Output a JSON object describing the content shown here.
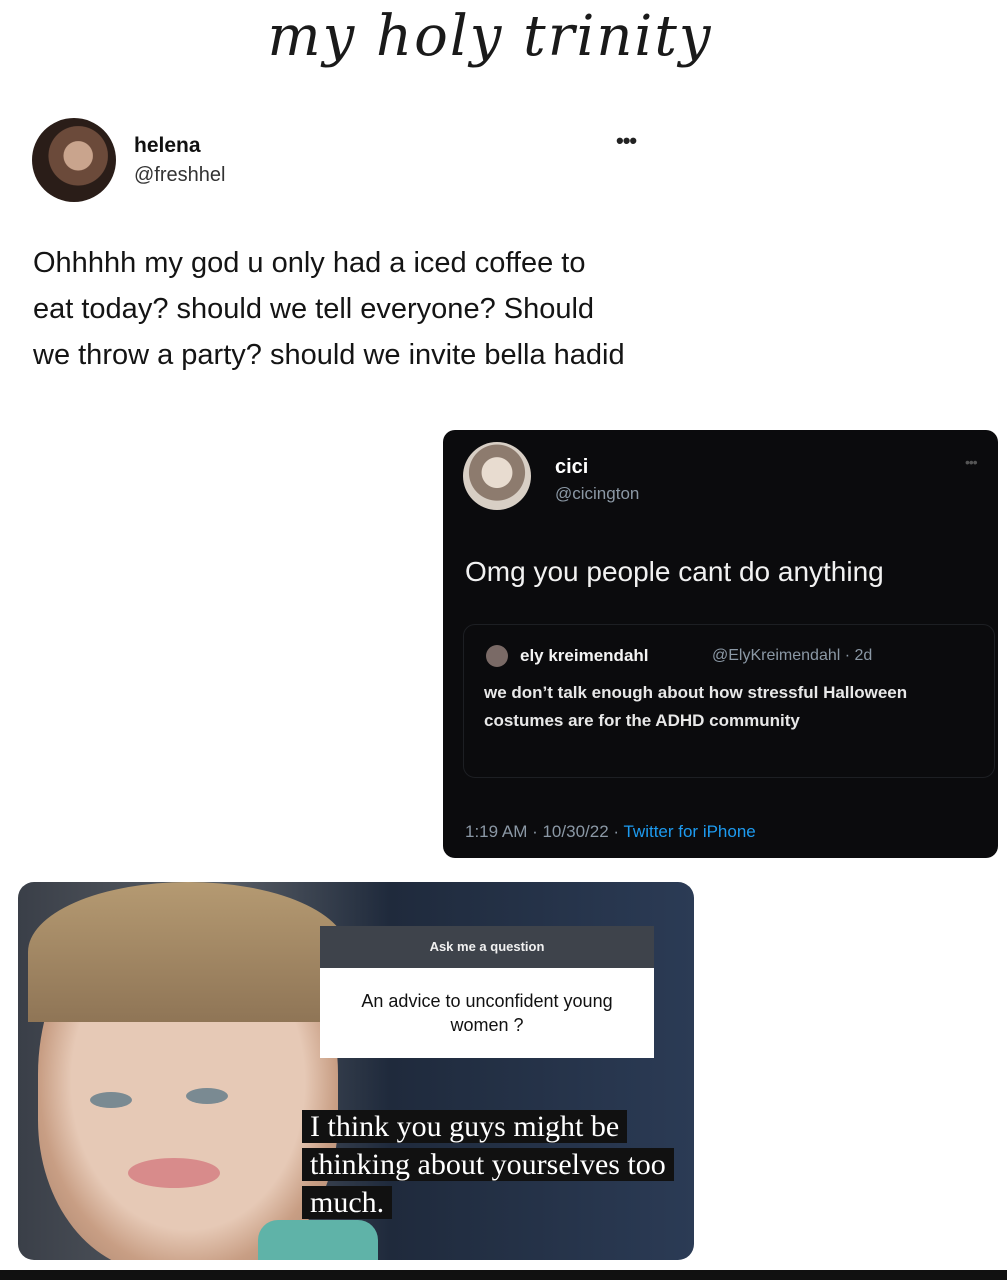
{
  "title": "my holy trinity",
  "tweet1": {
    "name": "helena",
    "handle": "@freshhel",
    "more": "•••",
    "text": "Ohhhhh my god u only had a iced coffee to eat today? should we tell everyone? Should we throw a party? should we invite bella hadid"
  },
  "tweet2": {
    "name": "cici",
    "handle": "@cicington",
    "more": "•••",
    "text": "Omg you people cant do anything",
    "quote": {
      "name": "ely kreimendahl",
      "handle_time": "@ElyKreimendahl · 2d",
      "text": "we don’t talk enough about how stressful Halloween costumes are for the ADHD community"
    },
    "footer_time": "1:19 AM · 10/30/22 · ",
    "footer_via": "Twitter for iPhone"
  },
  "story": {
    "ask_label": "Ask me a question",
    "question": "An advice to unconfident young women ?",
    "answer": "I think you guys might be thinking about yourselves too much."
  }
}
